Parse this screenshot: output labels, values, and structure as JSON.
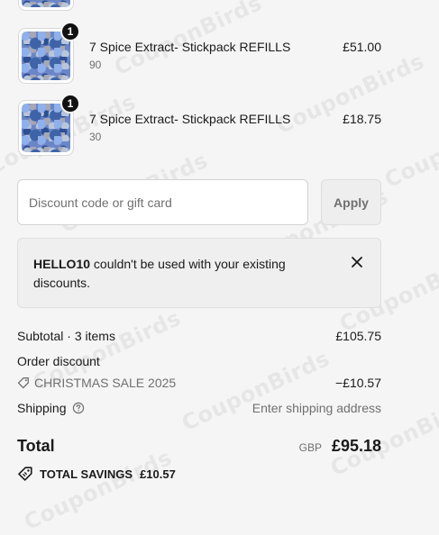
{
  "watermark": "CouponBirds",
  "line_items": [
    {
      "title": "7 Spice Extract- Stickpack REFILLS",
      "variant": "90",
      "price": "£51.00",
      "quantity": "1"
    },
    {
      "title": "7 Spice Extract- Stickpack REFILLS",
      "variant": "30",
      "price": "£18.75",
      "quantity": "1"
    }
  ],
  "discount": {
    "placeholder": "Discount code or gift card",
    "apply_label": "Apply"
  },
  "notice": {
    "code": "HELLO10",
    "message": " couldn't be used with your existing discounts."
  },
  "summary": {
    "subtotal_label": "Subtotal · 3 items",
    "subtotal_value": "£105.75",
    "order_discount_label": "Order discount",
    "discount_code": "CHRISTMAS SALE 2025",
    "discount_value": "−£10.57",
    "shipping_label": "Shipping",
    "shipping_value": "Enter shipping address",
    "total_label": "Total",
    "currency": "GBP",
    "total_value": "£95.18",
    "savings_label": "TOTAL SAVINGS",
    "savings_value": "£10.57"
  },
  "icons": {
    "close": "close-icon",
    "tag": "tag-icon",
    "help": "question-circle-icon",
    "savings_tag": "tag-icon"
  }
}
